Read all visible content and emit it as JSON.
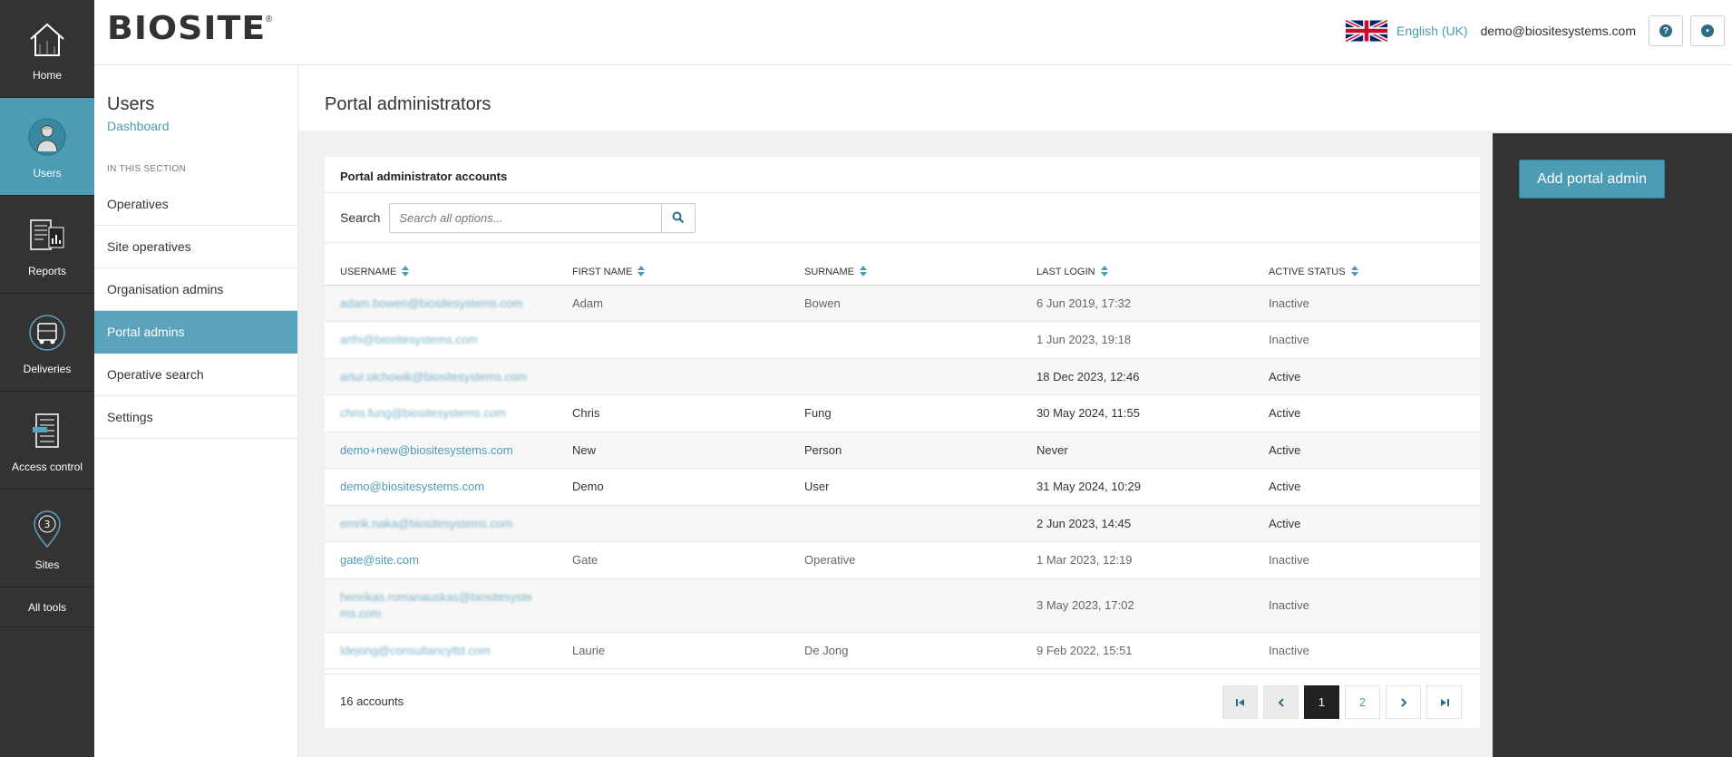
{
  "rail": {
    "items": [
      {
        "label": "Home",
        "icon": "home-icon"
      },
      {
        "label": "Users",
        "icon": "users-icon",
        "active": true
      },
      {
        "label": "Reports",
        "icon": "reports-icon"
      },
      {
        "label": "Deliveries",
        "icon": "deliveries-icon"
      },
      {
        "label": "Access control",
        "icon": "access-control-icon"
      },
      {
        "label": "Sites",
        "icon": "sites-icon"
      }
    ],
    "all_tools": "All tools",
    "sites_badge": "3"
  },
  "header": {
    "logo": "BIOSITE",
    "logo_mark": "®",
    "language": "English (UK)",
    "account_email": "demo@biositesystems.com",
    "help_glyph": "?",
    "user_glyph": "•"
  },
  "subnav": {
    "title": "Users",
    "breadcrumb": "Dashboard",
    "section_label": "IN THIS SECTION",
    "items": [
      {
        "label": "Operatives"
      },
      {
        "label": "Site operatives"
      },
      {
        "label": "Organisation admins"
      },
      {
        "label": "Portal admins",
        "active": true
      },
      {
        "label": "Operative search"
      },
      {
        "label": "Settings"
      }
    ]
  },
  "page": {
    "title": "Portal administrators"
  },
  "panel": {
    "title": "Portal administrator accounts",
    "search_label": "Search",
    "search_placeholder": "Search all options...",
    "columns": [
      "USERNAME",
      "FIRST NAME",
      "SURNAME",
      "LAST LOGIN",
      "ACTIVE STATUS"
    ],
    "rows": [
      {
        "username": "adam.bowen@biositesystems.com",
        "first": "Adam",
        "surname": "Bowen",
        "last_login": "6 Jun 2019, 17:32",
        "status": "Inactive",
        "blurred": true
      },
      {
        "username": "arthi@biositesystems.com",
        "first": "",
        "surname": "",
        "last_login": "1 Jun 2023, 19:18",
        "status": "Inactive",
        "blurred": true
      },
      {
        "username": "artur.olchowik@biositesystems.com",
        "first": "",
        "surname": "",
        "last_login": "18 Dec 2023, 12:46",
        "status": "Active",
        "blurred": true
      },
      {
        "username": "chris.fung@biositesystems.com",
        "first": "Chris",
        "surname": "Fung",
        "last_login": "30 May 2024, 11:55",
        "status": "Active",
        "blurred": true
      },
      {
        "username": "demo+new@biositesystems.com",
        "first": "New",
        "surname": "Person",
        "last_login": "Never",
        "status": "Active",
        "blurred": false
      },
      {
        "username": "demo@biositesystems.com",
        "first": "Demo",
        "surname": "User",
        "last_login": "31 May 2024, 10:29",
        "status": "Active",
        "blurred": false
      },
      {
        "username": "emrik.naka@biositesystems.com",
        "first": "",
        "surname": "",
        "last_login": "2 Jun 2023, 14:45",
        "status": "Active",
        "blurred": true
      },
      {
        "username": "gate@site.com",
        "first": "Gate",
        "surname": "Operative",
        "last_login": "1 Mar 2023, 12:19",
        "status": "Inactive",
        "blurred": false
      },
      {
        "username": "henrikas.romanauskas@biositesystems.com",
        "first": "",
        "surname": "",
        "last_login": "3 May 2023, 17:02",
        "status": "Inactive",
        "blurred": true,
        "tall": true
      },
      {
        "username": "ldejong@consultancyltd.com",
        "first": "Laurie",
        "surname": "De Jong",
        "last_login": "9 Feb 2022, 15:51",
        "status": "Inactive",
        "blurred": true
      }
    ],
    "count_text": "16 accounts",
    "pages": [
      "1",
      "2"
    ],
    "current_page": "1"
  },
  "actions": {
    "add_label": "Add portal admin"
  },
  "colors": {
    "accent": "#4b9cb4",
    "rail": "#333333",
    "active_nav": "#5ba3bc"
  }
}
